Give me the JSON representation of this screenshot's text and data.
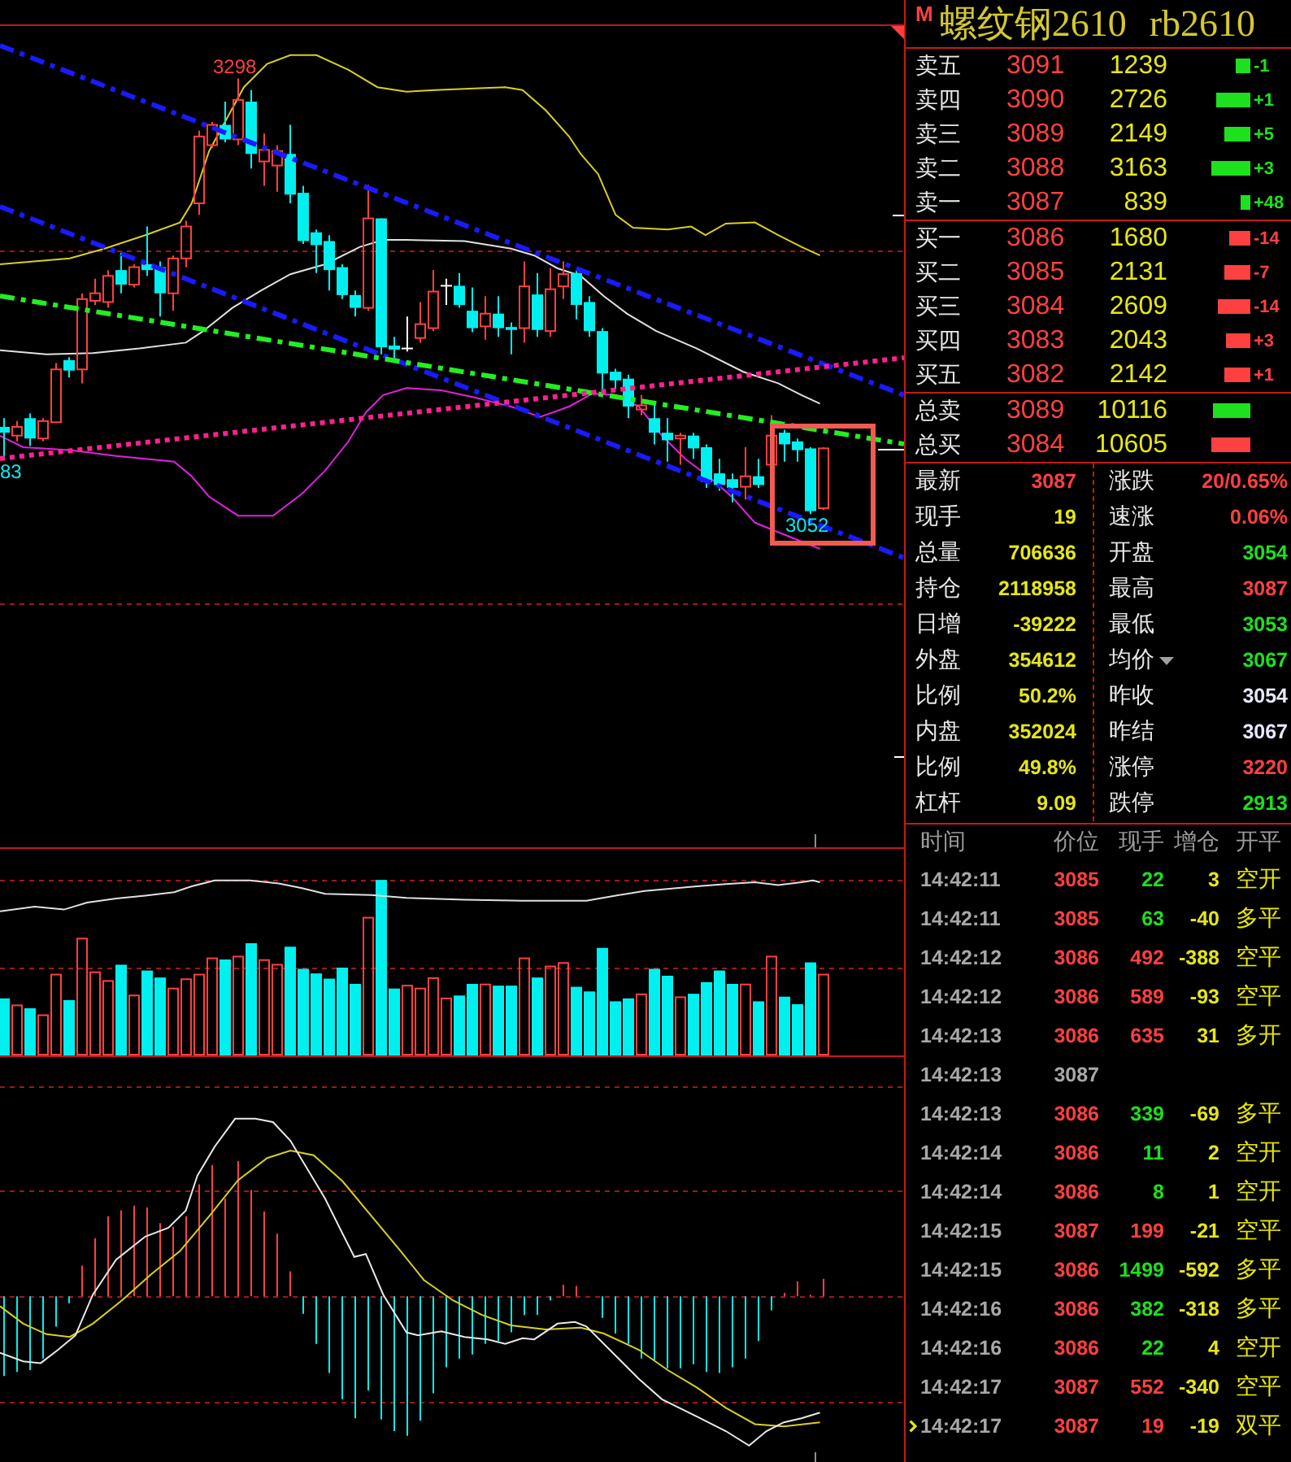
{
  "chart": {
    "price_labels": [
      {
        "text": "3298",
        "kind": "high"
      },
      {
        "text": "83",
        "kind": "edge"
      },
      {
        "text": "3052",
        "kind": "low"
      }
    ]
  },
  "instrument": {
    "flag": "M",
    "name": "螺纹钢2610",
    "code": "rb2610"
  },
  "order_book": {
    "asks": [
      {
        "label": "卖五",
        "price": "3091",
        "volume": "1239",
        "change": "-1"
      },
      {
        "label": "卖四",
        "price": "3090",
        "volume": "2726",
        "change": "+1"
      },
      {
        "label": "卖三",
        "price": "3089",
        "volume": "2149",
        "change": "+5"
      },
      {
        "label": "卖二",
        "price": "3088",
        "volume": "3163",
        "change": "+3"
      },
      {
        "label": "卖一",
        "price": "3087",
        "volume": "839",
        "change": "+48"
      }
    ],
    "bids": [
      {
        "label": "买一",
        "price": "3086",
        "volume": "1680",
        "change": "-14"
      },
      {
        "label": "买二",
        "price": "3085",
        "volume": "2131",
        "change": "-7"
      },
      {
        "label": "买三",
        "price": "3084",
        "volume": "2609",
        "change": "-14"
      },
      {
        "label": "买四",
        "price": "3083",
        "volume": "2043",
        "change": "+3"
      },
      {
        "label": "买五",
        "price": "3082",
        "volume": "2142",
        "change": "+1"
      }
    ],
    "totals": [
      {
        "label": "总卖",
        "price": "3089",
        "volume": "10116",
        "color": "#1ee01e"
      },
      {
        "label": "总买",
        "price": "3084",
        "volume": "10605",
        "color": "#ff4040"
      }
    ]
  },
  "stats": {
    "left": [
      {
        "label": "最新",
        "value": "3087",
        "color": "#ff4040"
      },
      {
        "label": "现手",
        "value": "19",
        "color": "#e6e619"
      },
      {
        "label": "总量",
        "value": "706636",
        "color": "#e6e619"
      },
      {
        "label": "持仓",
        "value": "2118958",
        "color": "#e6e619"
      },
      {
        "label": "日增",
        "value": "-39222",
        "color": "#e6e619"
      },
      {
        "label": "外盘",
        "value": "354612",
        "color": "#e6e619"
      },
      {
        "label": "比例",
        "value": "50.2%",
        "color": "#e6e619"
      },
      {
        "label": "内盘",
        "value": "352024",
        "color": "#e6e619"
      },
      {
        "label": "比例",
        "value": "49.8%",
        "color": "#e6e619"
      },
      {
        "label": "杠杆",
        "value": "9.09",
        "color": "#e6e619"
      }
    ],
    "right": [
      {
        "label": "涨跌",
        "value": "20/0.65%",
        "color": "#ff4040"
      },
      {
        "label": "速涨",
        "value": "0.06%",
        "color": "#ff4040"
      },
      {
        "label": "开盘",
        "value": "3054",
        "color": "#1ee01e"
      },
      {
        "label": "最高",
        "value": "3087",
        "color": "#ff4040"
      },
      {
        "label": "最低",
        "value": "3053",
        "color": "#1ee01e"
      },
      {
        "label": "均价",
        "value": "3067",
        "color": "#1ee01e",
        "dropdown": true
      },
      {
        "label": "昨收",
        "value": "3054",
        "color": "#e8e8ff"
      },
      {
        "label": "昨结",
        "value": "3067",
        "color": "#e8e8ff"
      },
      {
        "label": "涨停",
        "value": "3220",
        "color": "#ff4040"
      },
      {
        "label": "跌停",
        "value": "2913",
        "color": "#1ee01e"
      }
    ]
  },
  "trades": {
    "columns": [
      "时间",
      "价位",
      "现手",
      "增仓",
      "开平"
    ],
    "rows": [
      {
        "kind": "trade",
        "time": "14:42:11",
        "price": "3085",
        "volume": "22",
        "change": "3",
        "action": "空开",
        "color": "#1ee01e",
        "current": false
      },
      {
        "kind": "trade",
        "time": "14:42:11",
        "price": "3085",
        "volume": "63",
        "change": "-40",
        "action": "多平",
        "color": "#1ee01e",
        "current": false
      },
      {
        "kind": "trade",
        "time": "14:42:12",
        "price": "3086",
        "volume": "492",
        "change": "-388",
        "action": "空平",
        "color": "#ff4040",
        "current": false
      },
      {
        "kind": "trade",
        "time": "14:42:12",
        "price": "3086",
        "volume": "589",
        "change": "-93",
        "action": "空平",
        "color": "#ff4040",
        "current": false
      },
      {
        "kind": "trade",
        "time": "14:42:13",
        "price": "3086",
        "volume": "635",
        "change": "31",
        "action": "多开",
        "color": "#ff4040",
        "current": false
      },
      {
        "kind": "quote",
        "time": "14:42:13",
        "price": "3087",
        "current": false
      },
      {
        "kind": "trade",
        "time": "14:42:13",
        "price": "3086",
        "volume": "339",
        "change": "-69",
        "action": "多平",
        "color": "#1ee01e",
        "current": false
      },
      {
        "kind": "trade",
        "time": "14:42:14",
        "price": "3086",
        "volume": "11",
        "change": "2",
        "action": "空开",
        "color": "#1ee01e",
        "current": false
      },
      {
        "kind": "trade",
        "time": "14:42:14",
        "price": "3086",
        "volume": "8",
        "change": "1",
        "action": "空开",
        "color": "#1ee01e",
        "current": false
      },
      {
        "kind": "trade",
        "time": "14:42:15",
        "price": "3087",
        "volume": "199",
        "change": "-21",
        "action": "空平",
        "color": "#ff4040",
        "current": false
      },
      {
        "kind": "trade",
        "time": "14:42:15",
        "price": "3086",
        "volume": "1499",
        "change": "-592",
        "action": "多平",
        "color": "#1ee01e",
        "current": false
      },
      {
        "kind": "trade",
        "time": "14:42:16",
        "price": "3086",
        "volume": "382",
        "change": "-318",
        "action": "多平",
        "color": "#1ee01e",
        "current": false
      },
      {
        "kind": "trade",
        "time": "14:42:16",
        "price": "3086",
        "volume": "22",
        "change": "4",
        "action": "空开",
        "color": "#1ee01e",
        "current": false
      },
      {
        "kind": "trade",
        "time": "14:42:17",
        "price": "3087",
        "volume": "552",
        "change": "-340",
        "action": "空平",
        "color": "#ff4040",
        "current": false
      },
      {
        "kind": "trade",
        "time": "14:42:17",
        "price": "3087",
        "volume": "19",
        "change": "-19",
        "action": "双平",
        "color": "#ff4040",
        "current": true
      }
    ]
  }
}
